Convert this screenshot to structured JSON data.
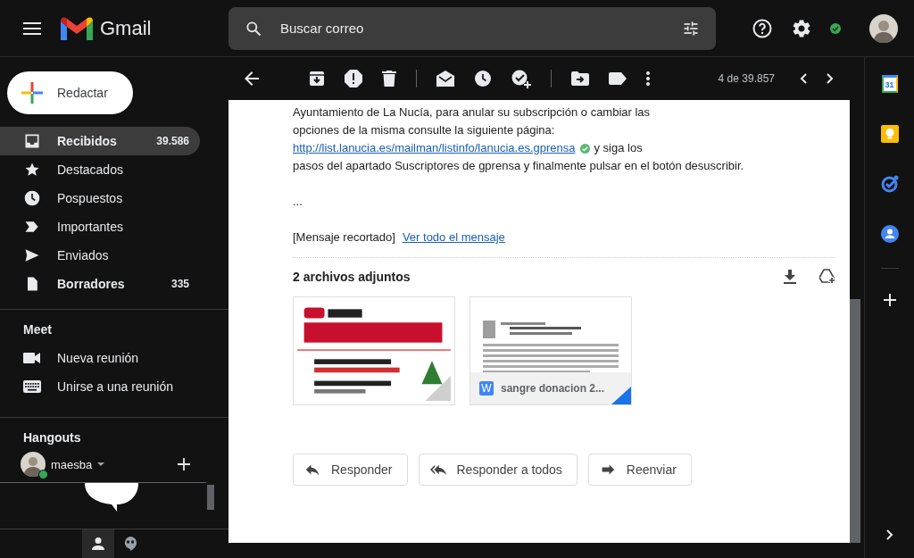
{
  "header": {
    "app_name": "Gmail",
    "search": {
      "placeholder": "Buscar correo"
    },
    "online": true
  },
  "compose": {
    "label": "Redactar"
  },
  "folders": [
    {
      "kind": "inbox",
      "label": "Recibidos",
      "count": "39.586",
      "selected": true,
      "unread": true
    },
    {
      "kind": "star",
      "label": "Destacados",
      "selected": false,
      "unread": false
    },
    {
      "kind": "clock",
      "label": "Pospuestos",
      "selected": false,
      "unread": false
    },
    {
      "kind": "important",
      "label": "Importantes",
      "selected": false,
      "unread": false
    },
    {
      "kind": "send",
      "label": "Enviados",
      "selected": false,
      "unread": false
    },
    {
      "kind": "draft",
      "label": "Borradores",
      "count": "335",
      "selected": false,
      "unread": true
    }
  ],
  "meet": {
    "title": "Meet",
    "items": [
      {
        "kind": "video",
        "label": "Nueva reunión"
      },
      {
        "kind": "keyboard",
        "label": "Unirse a una reunión"
      }
    ]
  },
  "hangouts": {
    "title": "Hangouts",
    "user": "maesba",
    "online": true,
    "tabs": [
      {
        "kind": "people",
        "selected": true
      },
      {
        "kind": "chat",
        "selected": false
      }
    ]
  },
  "toolbar": {
    "counter": "4 de 39.857"
  },
  "message": {
    "lines": [
      "Ayuntamiento de La Nucía, para anular su subscripción o cambiar las",
      "opciones de la misma consulte la siguiente página:"
    ],
    "link": "http://list.lanucia.es/mailman/listinfo/lanucia.es.gprensa",
    "link_verified": true,
    "after_link": "y siga los",
    "closing": "pasos del apartado Suscriptores de gprensa y finalmente pulsar en el botón desuscribir.",
    "ellipsis": "...",
    "clipped_note": "[Mensaje recortado]",
    "view_all": "Ver todo el mensaje"
  },
  "attachments": {
    "title": "2 archivos adjuntos",
    "items": [
      {
        "kind": "picture"
      },
      {
        "kind": "document",
        "icon_letter": "W",
        "name": "sangre donacion 2..."
      }
    ]
  },
  "reply_buttons": [
    {
      "kind": "reply",
      "label": "Responder"
    },
    {
      "kind": "reply_all",
      "label": "Responder a todos"
    },
    {
      "kind": "forward",
      "label": "Reenviar"
    }
  ],
  "side_panel": {
    "calendar_day": "31"
  }
}
